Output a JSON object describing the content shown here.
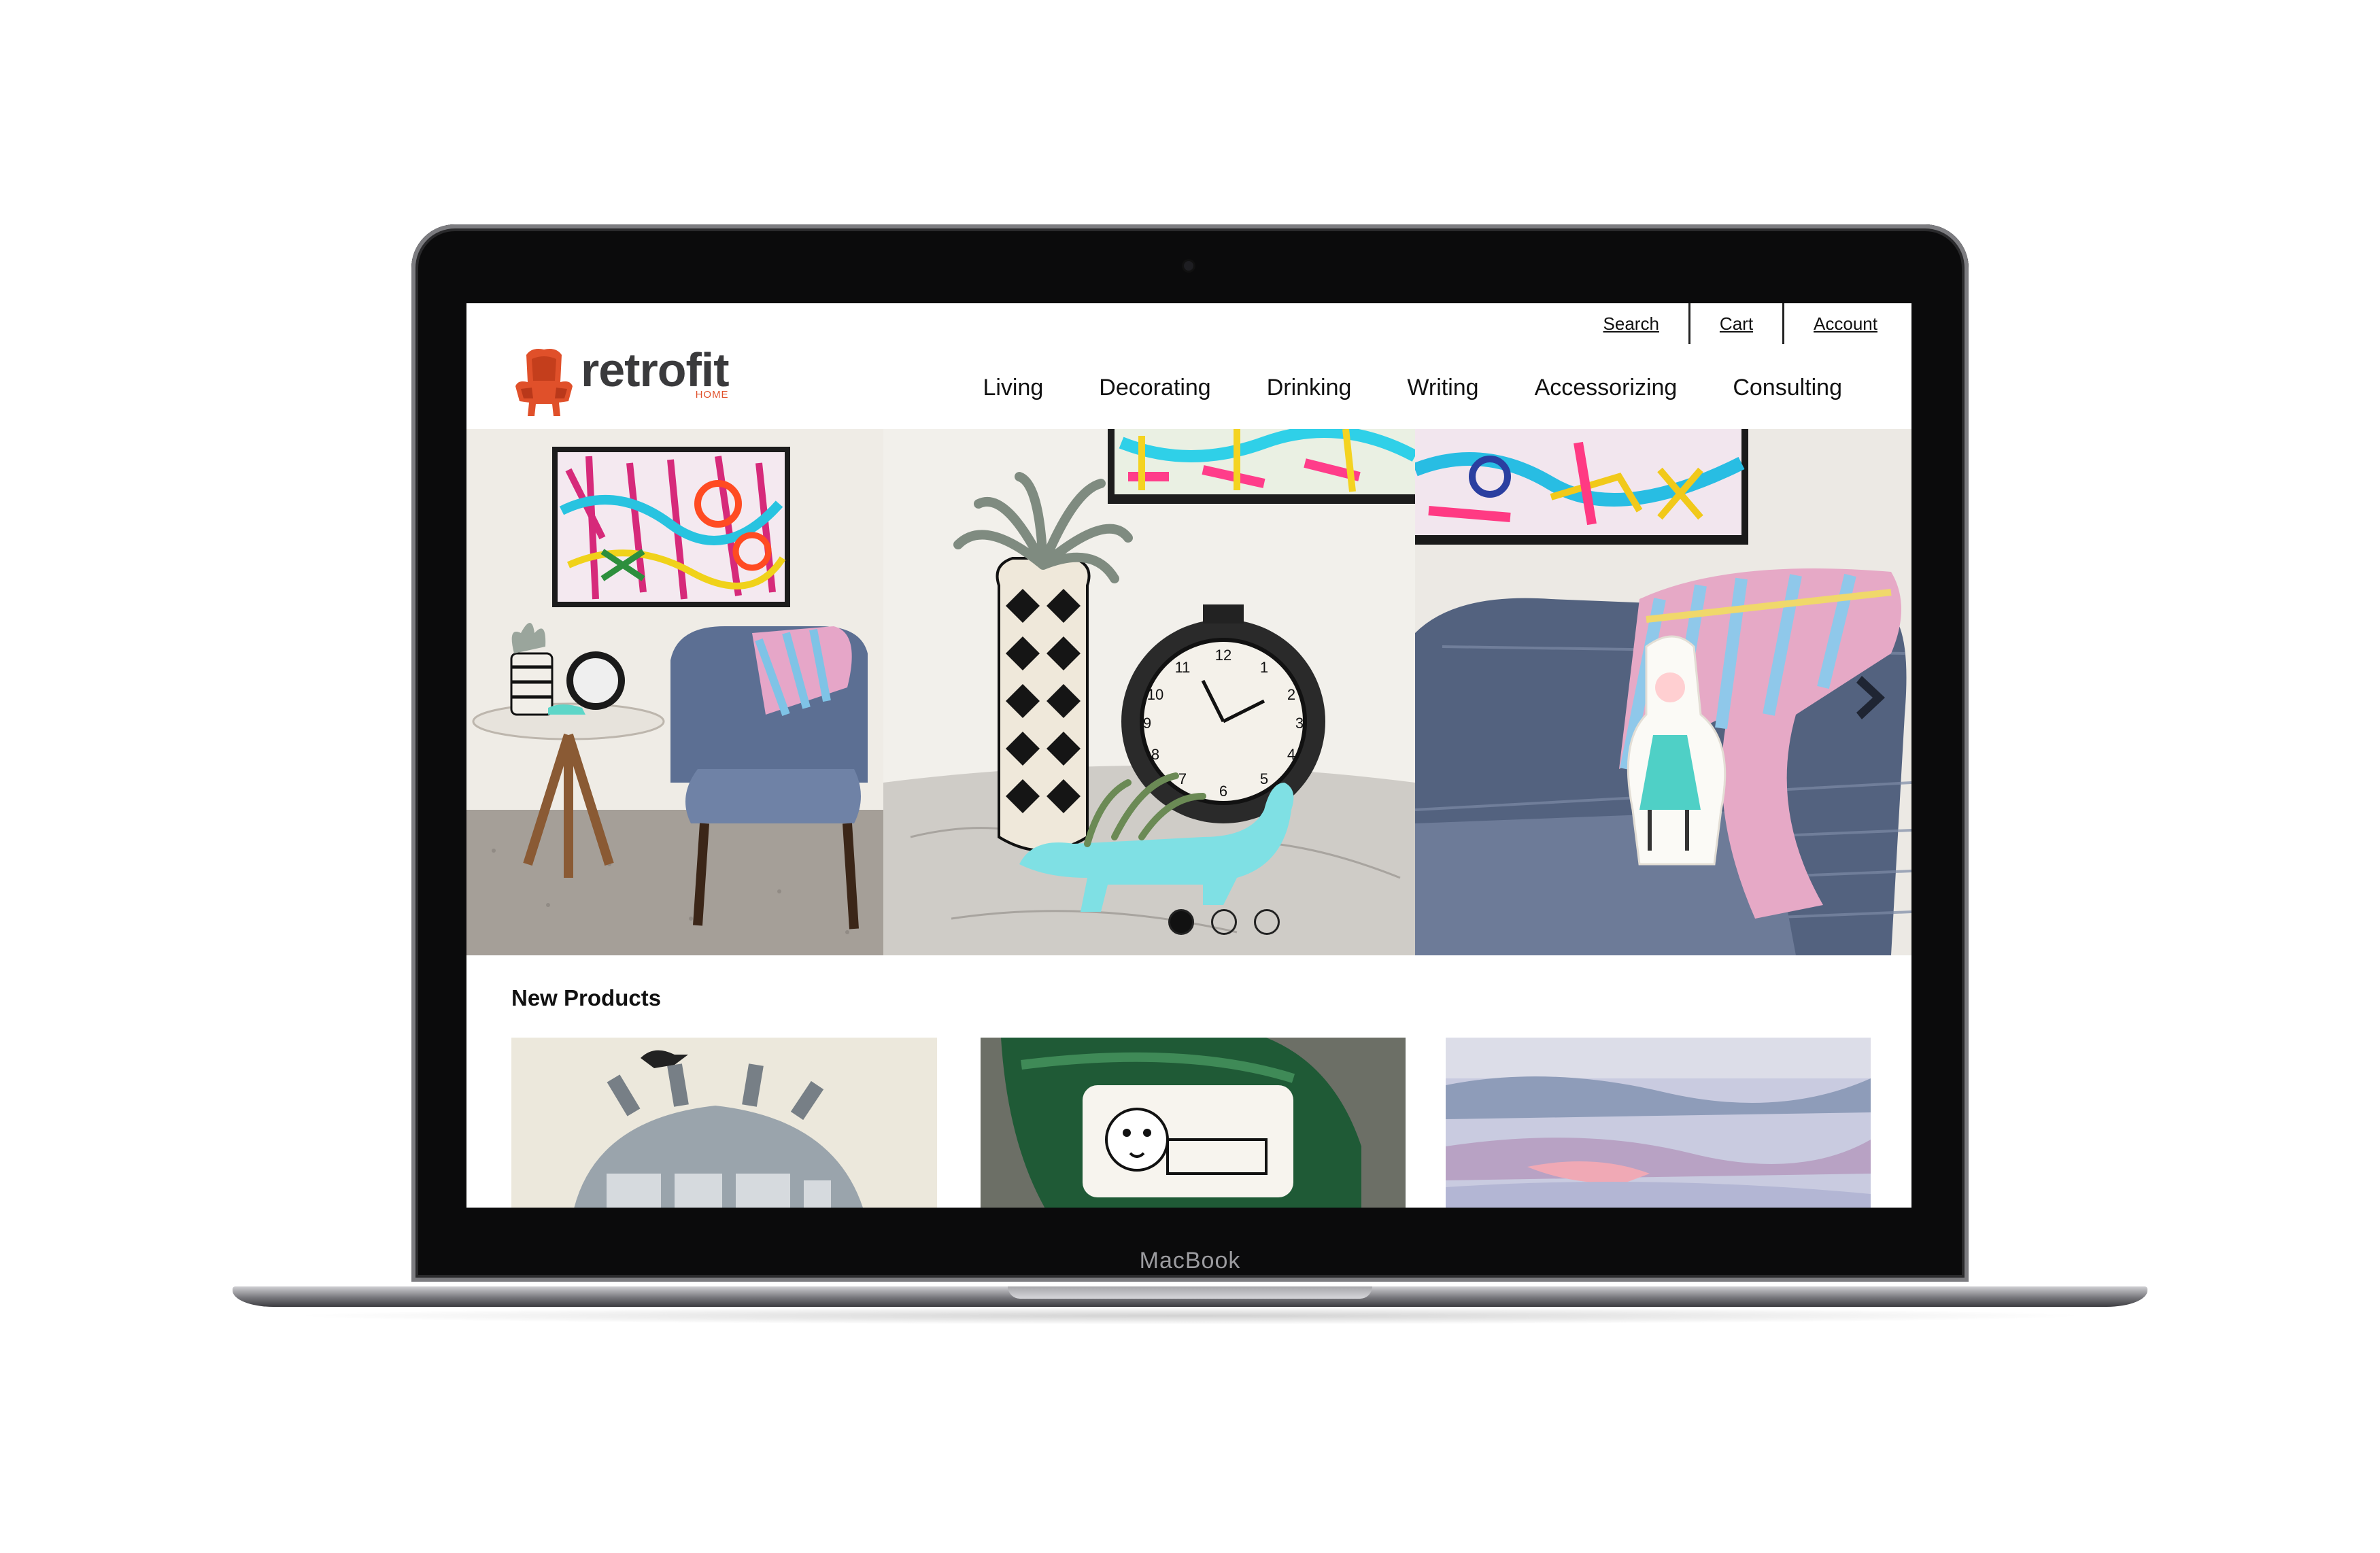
{
  "device": {
    "label": "MacBook"
  },
  "site": {
    "brand": {
      "name": "retrofit",
      "tagline": "HOME",
      "logo_icon": "armchair-icon"
    },
    "utility_nav": [
      {
        "label": "Search"
      },
      {
        "label": "Cart"
      },
      {
        "label": "Account"
      }
    ],
    "main_nav": [
      {
        "label": "Living"
      },
      {
        "label": "Decorating"
      },
      {
        "label": "Drinking"
      },
      {
        "label": "Writing"
      },
      {
        "label": "Accessorizing"
      },
      {
        "label": "Consulting"
      }
    ],
    "carousel": {
      "dots": 3,
      "active_index": 0,
      "next_icon": "chevron-right-icon"
    },
    "new_products": {
      "title": "New Products"
    }
  },
  "colors": {
    "brand_orange": "#e0502a",
    "logo_text": "#3a3a3c",
    "bezel": "#0b0b0c"
  }
}
